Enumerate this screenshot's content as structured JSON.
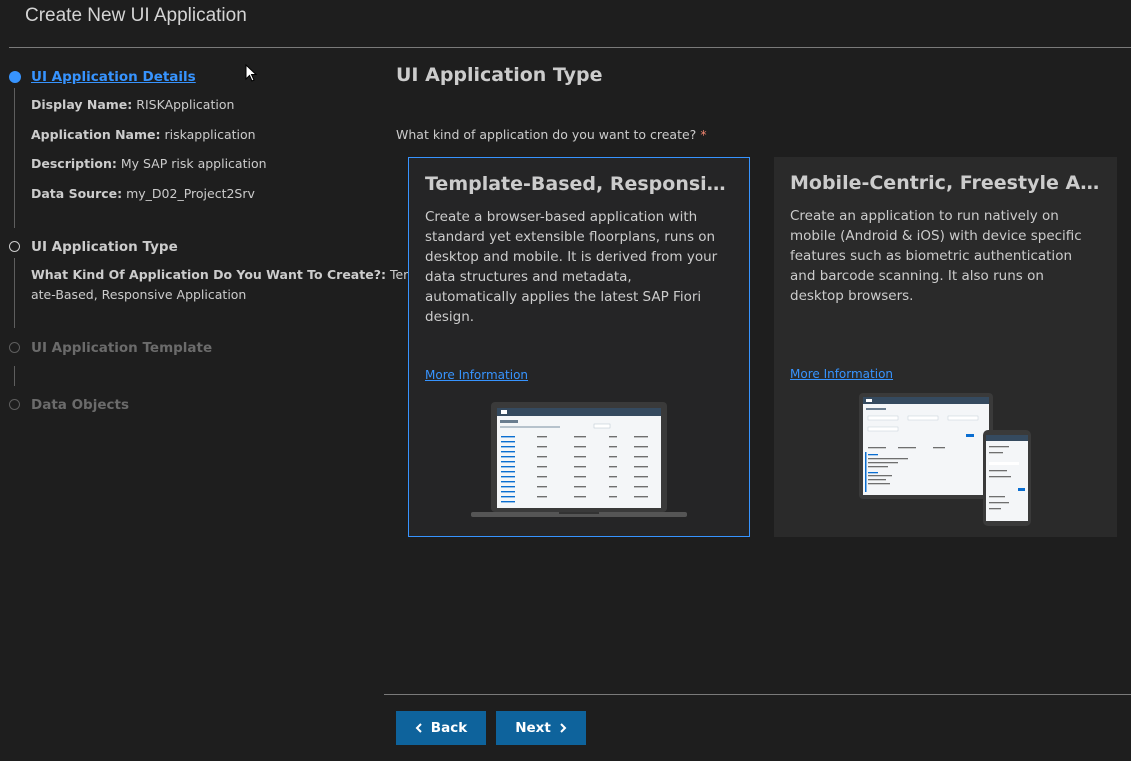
{
  "header": {
    "title": "Create New UI Application"
  },
  "steps": [
    {
      "title": "UI Application Details",
      "details": [
        {
          "label": "Display Name:",
          "value": "RISKApplication"
        },
        {
          "label": "Application Name:",
          "value": "riskapplication"
        },
        {
          "label": "Description:",
          "value": "My SAP risk application"
        },
        {
          "label": "Data Source:",
          "value": "my_D02_Project2Srv"
        }
      ]
    },
    {
      "title": "UI Application Type",
      "details": [
        {
          "label": "What Kind Of Application Do You Want To Create?:",
          "value": "Templ",
          "value2": "ate-Based, Responsive Application"
        }
      ]
    },
    {
      "title": "UI Application Template"
    },
    {
      "title": "Data Objects"
    }
  ],
  "main": {
    "title": "UI Application Type",
    "question": "What kind of application do you want to create?",
    "required_mark": "*",
    "cards": [
      {
        "title": "Template-Based, Responsive Application",
        "description": "Create a browser-based application with standard yet extensible floorplans, runs on desktop and mobile. It is derived from your data structures and metadata, automatically applies the latest SAP Fiori design.",
        "link": "More Information",
        "selected": true
      },
      {
        "title": "Mobile-Centric, Freestyle Application",
        "description": "Create an application to run natively on mobile (Android & iOS) with device specific features such as biometric authentication and barcode scanning. It also runs on desktop browsers.",
        "link": "More Information",
        "selected": false
      }
    ]
  },
  "footer": {
    "back_label": "Back",
    "next_label": "Next"
  },
  "colors": {
    "accent": "#3794ff",
    "button": "#0e639c",
    "background": "#1e1e1e"
  }
}
